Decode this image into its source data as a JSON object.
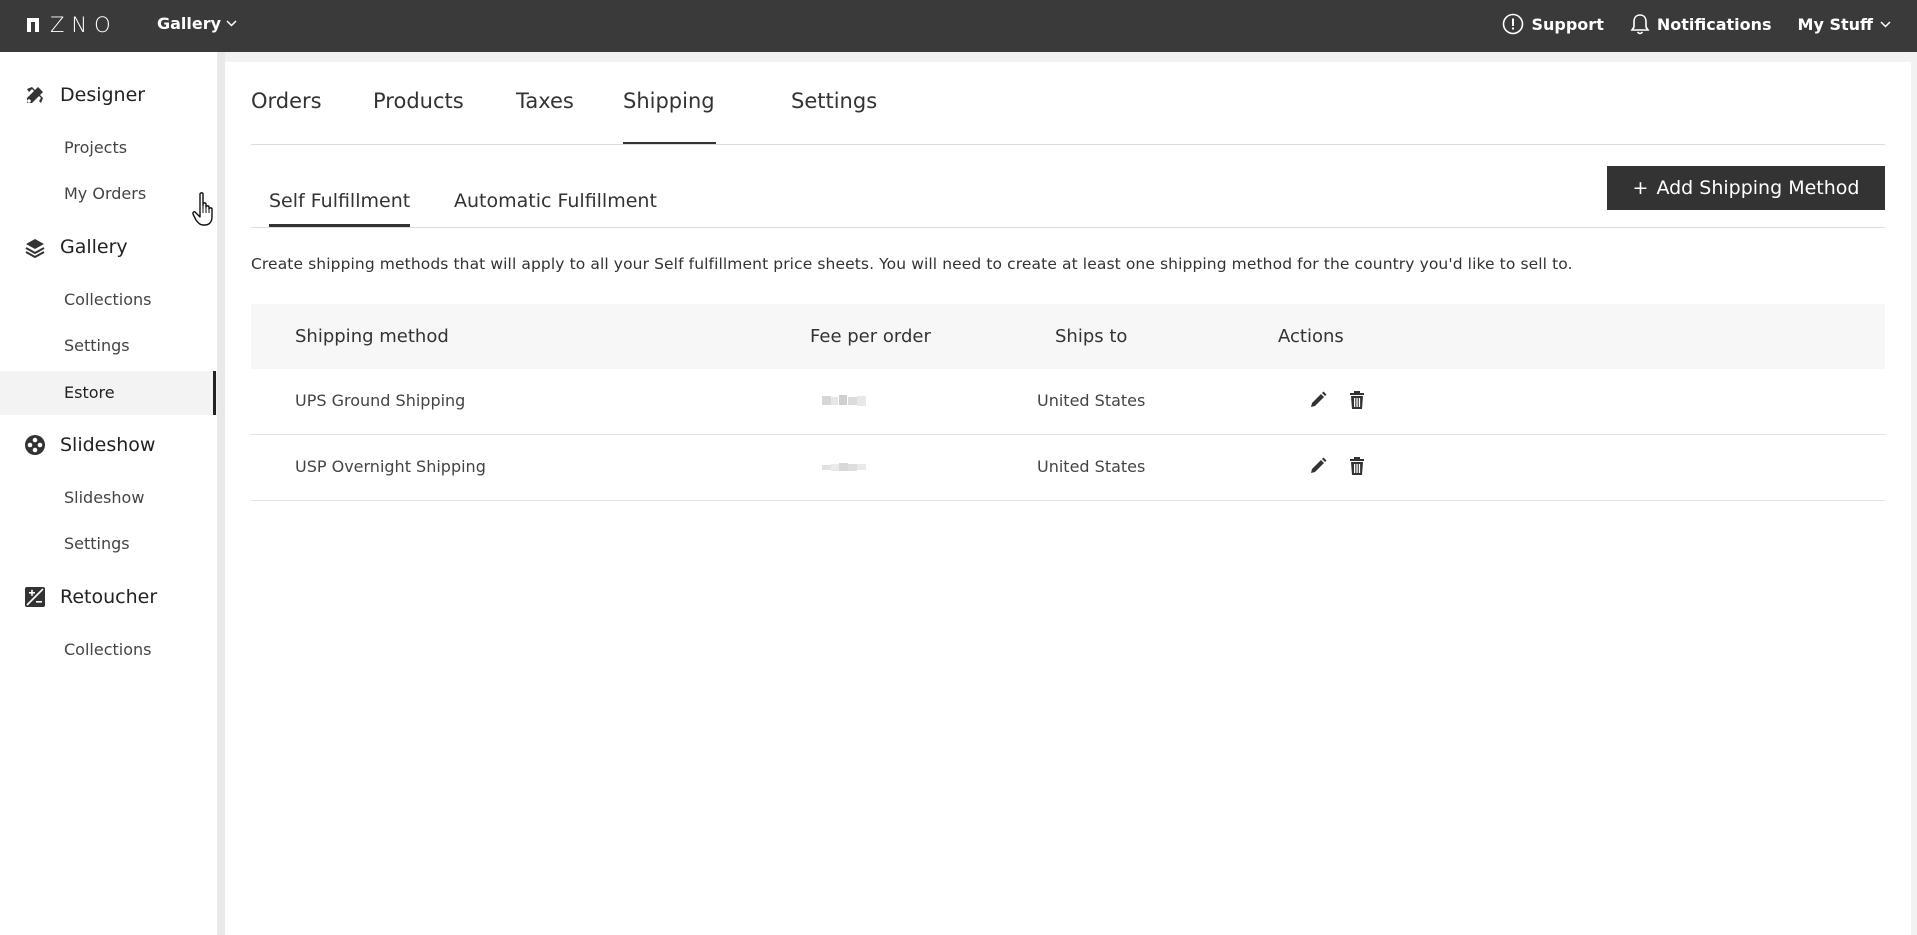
{
  "topbar": {
    "logo_text": "ZNO",
    "product_switch": "Gallery",
    "support": "Support",
    "notifications": "Notifications",
    "my_stuff": "My Stuff"
  },
  "sidebar": {
    "sections": [
      {
        "label": "Designer",
        "icon": "designer-icon",
        "items": [
          "Projects",
          "My Orders"
        ]
      },
      {
        "label": "Gallery",
        "icon": "layers-icon",
        "items": [
          "Collections",
          "Settings",
          "Estore"
        ]
      },
      {
        "label": "Slideshow",
        "icon": "film-reel-icon",
        "items": [
          "Slideshow",
          "Settings"
        ]
      },
      {
        "label": "Retoucher",
        "icon": "retoucher-icon",
        "items": [
          "Collections"
        ]
      }
    ],
    "active_item": "Estore"
  },
  "tabs": [
    "Orders",
    "Products",
    "Taxes",
    "Shipping",
    "Settings"
  ],
  "active_tab": "Shipping",
  "subtabs": [
    "Self Fulfillment",
    "Automatic Fulfillment"
  ],
  "active_subtab": "Self Fulfillment",
  "add_button": {
    "icon": "+",
    "label": "Add Shipping Method"
  },
  "description": "Create shipping methods that will apply to all your Self fulfillment price sheets. You will need to create at least one shipping method for the country you'd like to sell to.",
  "table": {
    "headers": [
      "Shipping method",
      "Fee per order",
      "Ships to",
      "Actions"
    ],
    "rows": [
      {
        "method": "UPS Ground Shipping",
        "ships_to": "United States"
      },
      {
        "method": "USP Overnight Shipping",
        "ships_to": "United States"
      }
    ]
  },
  "colors": {
    "topbar": "#3a3a3a",
    "accent": "#333333",
    "background": "#f2f2f2"
  }
}
